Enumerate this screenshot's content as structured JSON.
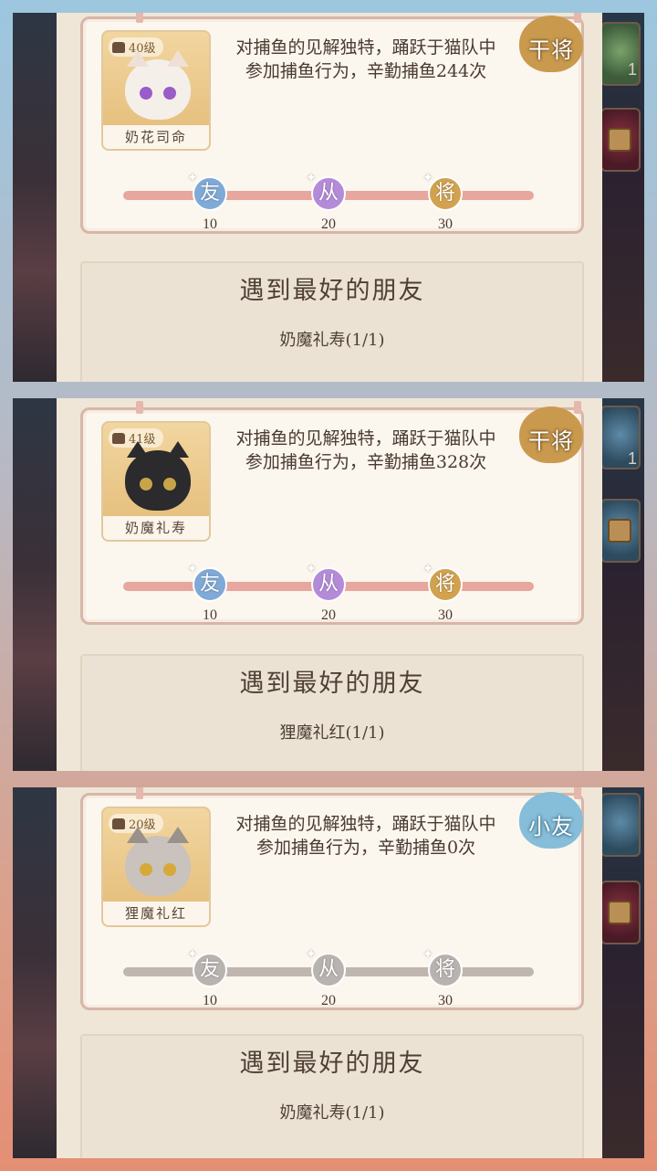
{
  "panels": [
    {
      "level": "40级",
      "name": "奶花司命",
      "description": "对捕鱼的见解独特，踊跃于猫队中参加捕鱼行为，辛勤捕鱼244次",
      "rank_badge": "干将",
      "badge_color": "#c99a4e",
      "milestones": [
        {
          "label": "友",
          "value": "10",
          "color": "#7fa9d6"
        },
        {
          "label": "从",
          "value": "20",
          "color": "#b48bd8"
        },
        {
          "label": "将",
          "value": "30",
          "color": "#d2a24f"
        }
      ],
      "track_color": "#e7a69e",
      "friends_title": "遇到最好的朋友",
      "friends_item": "奶魔礼寿(1/1)"
    },
    {
      "level": "41级",
      "name": "奶魔礼寿",
      "description": "对捕鱼的见解独特，踊跃于猫队中参加捕鱼行为，辛勤捕鱼328次",
      "rank_badge": "干将",
      "badge_color": "#c99a4e",
      "milestones": [
        {
          "label": "友",
          "value": "10",
          "color": "#7fa9d6"
        },
        {
          "label": "从",
          "value": "20",
          "color": "#b48bd8"
        },
        {
          "label": "将",
          "value": "30",
          "color": "#d2a24f"
        }
      ],
      "track_color": "#e7a69e",
      "friends_title": "遇到最好的朋友",
      "friends_item": "狸魔礼红(1/1)"
    },
    {
      "level": "20级",
      "name": "狸魔礼红",
      "description": "对捕鱼的见解独特，踊跃于猫队中参加捕鱼行为，辛勤捕鱼0次",
      "rank_badge": "小友",
      "badge_color": "#86bdd8",
      "milestones": [
        {
          "label": "友",
          "value": "10",
          "color": "#b9b3b0"
        },
        {
          "label": "从",
          "value": "20",
          "color": "#b9b3b0"
        },
        {
          "label": "将",
          "value": "30",
          "color": "#b9b3b0"
        }
      ],
      "track_color": "#bfb6b0",
      "friends_title": "遇到最好的朋友",
      "friends_item": "奶魔礼寿(1/1)"
    }
  ]
}
